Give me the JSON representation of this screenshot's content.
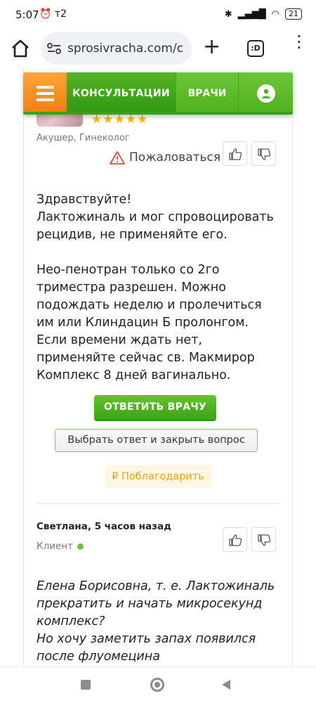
{
  "status_bar": {
    "time": "5:07",
    "carrier_icons": "⏰ т2",
    "battery": "21"
  },
  "browser": {
    "url": "sprosivracha.com/c",
    "tabs_label": ":D"
  },
  "nav": {
    "consultations": "КОНСУЛЬТАЦИИ",
    "doctors": "ВРАЧИ"
  },
  "doctor_answer": {
    "stars": "★★★★★",
    "specialty": "Акушер, Гинеколог",
    "report_label": "Пожаловаться",
    "lines": [
      "Здравствуйте!",
      "Лактожиналь и мог спровоцировать рецидив, не применяйте его.",
      "",
      "Нео-пенотран только со 2го триместра разрешен. Можно подождать неделю и пролечиться им или Клиндацин Б пролонгом.",
      "Если времени ждать нет, применяйте сейчас св. Макмирор Комплекс 8 дней вагинально."
    ],
    "reply_button": "ОТВЕТИТЬ ВРАЧУ",
    "choose_button": "Выбрать ответ и закрыть вопрос",
    "thanks_button": "₽ Поблагодарить"
  },
  "comment": {
    "author": "Светлана, 5 часов назад",
    "role": "Клиент",
    "lines": [
      "Елена Борисовна, т. е. Лактожиналь прекратить и начать микросекунд комплекс?",
      "Но хочу заметить запах появился после флуомецина"
    ]
  },
  "colors": {
    "brand_green": "#3ba416",
    "menu_orange": "#f07f10",
    "star_gold": "#f5b400",
    "thanks_orange": "#e2a12a"
  }
}
